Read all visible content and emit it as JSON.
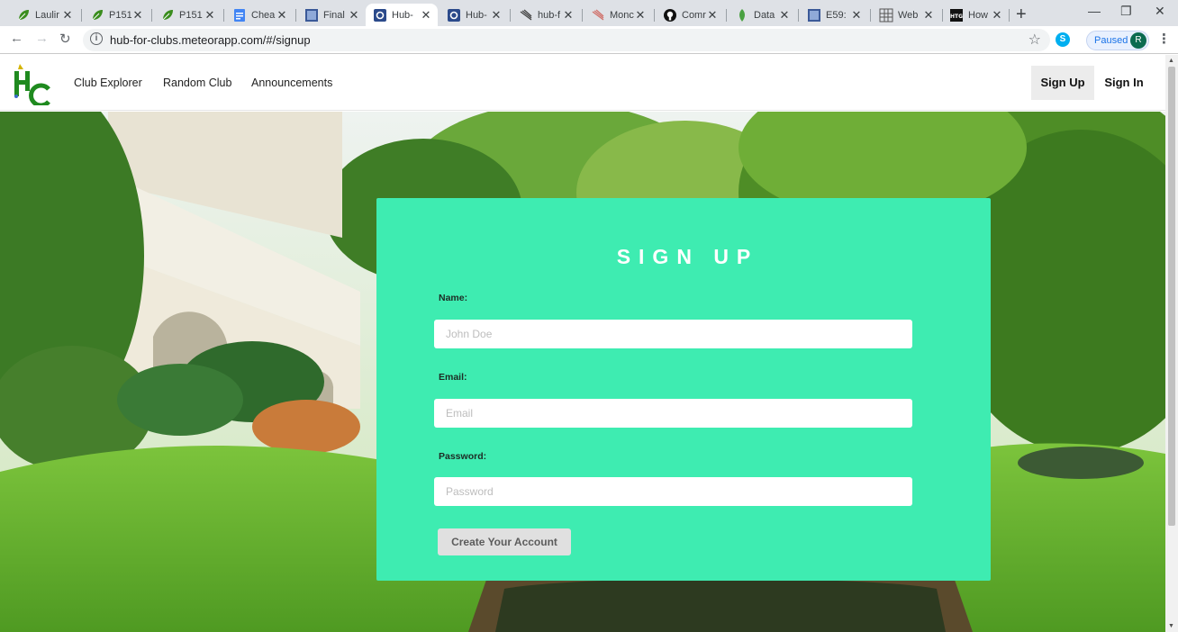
{
  "browser": {
    "tabs": [
      {
        "label": "Laulir",
        "icon": "leaf-icon"
      },
      {
        "label": "P151",
        "icon": "leaf-icon"
      },
      {
        "label": "P151",
        "icon": "leaf-icon"
      },
      {
        "label": "Chea",
        "icon": "google-docs-icon"
      },
      {
        "label": "Final",
        "icon": "doc-icon"
      },
      {
        "label": "Hub-",
        "icon": "hub-icon",
        "active": true
      },
      {
        "label": "Hub-",
        "icon": "hub-icon"
      },
      {
        "label": "hub-f",
        "icon": "feather-icon"
      },
      {
        "label": "Monc",
        "icon": "feather-icon"
      },
      {
        "label": "Comr",
        "icon": "github-icon"
      },
      {
        "label": "Data",
        "icon": "mongodb-leaf-icon"
      },
      {
        "label": "E59:",
        "icon": "doc-icon"
      },
      {
        "label": "Web",
        "icon": "grid-icon"
      },
      {
        "label": "How",
        "icon": "htg-icon"
      }
    ],
    "url": "hub-for-clubs.meteorapp.com/#/signup",
    "profile_status": "Paused",
    "profile_initial": "R"
  },
  "navbar": {
    "links": [
      "Club Explorer",
      "Random Club",
      "Announcements"
    ],
    "signup_label": "Sign Up",
    "signin_label": "Sign In"
  },
  "form": {
    "title": "SIGN UP",
    "name_label": "Name:",
    "name_placeholder": "John Doe",
    "email_label": "Email:",
    "email_placeholder": "Email",
    "password_label": "Password:",
    "password_placeholder": "Password",
    "submit_label": "Create Your Account"
  },
  "colors": {
    "card": "#3eecb1",
    "logo_green": "#1a8a1a"
  }
}
